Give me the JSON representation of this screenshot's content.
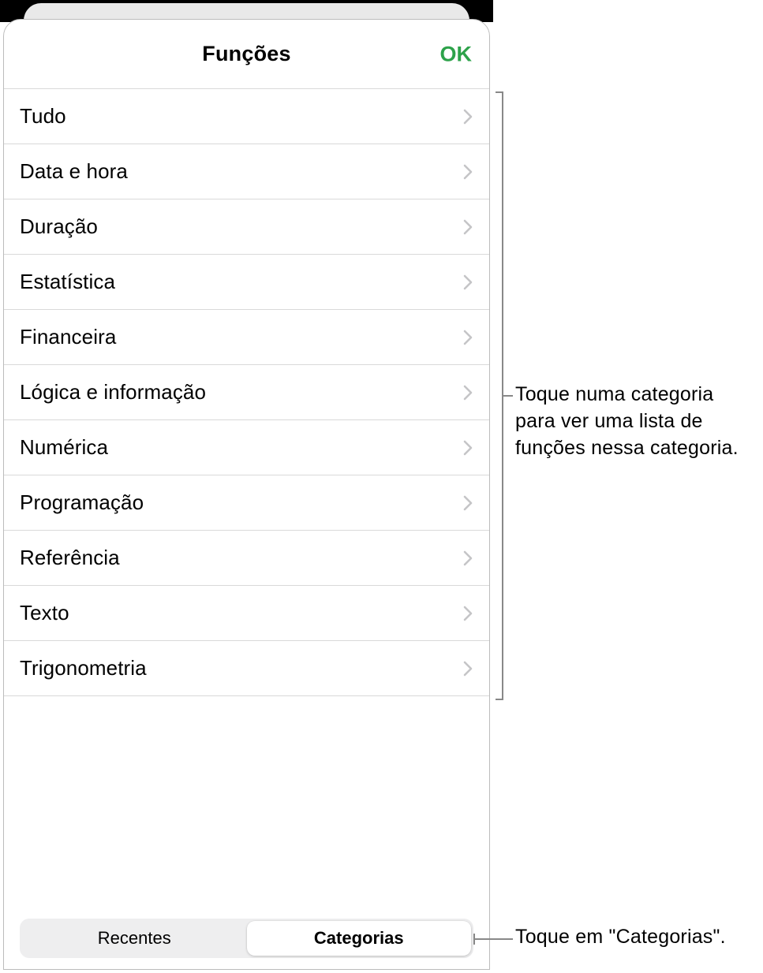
{
  "sheet": {
    "title": "Funções",
    "ok_label": "OK"
  },
  "categories": [
    {
      "label": "Tudo"
    },
    {
      "label": "Data e hora"
    },
    {
      "label": "Duração"
    },
    {
      "label": "Estatística"
    },
    {
      "label": "Financeira"
    },
    {
      "label": "Lógica e informação"
    },
    {
      "label": "Numérica"
    },
    {
      "label": "Programação"
    },
    {
      "label": "Referência"
    },
    {
      "label": "Texto"
    },
    {
      "label": "Trigonometria"
    }
  ],
  "segmented": {
    "recent_label": "Recentes",
    "categories_label": "Categorias",
    "selected": "categories"
  },
  "callouts": {
    "list": "Toque numa categoria para ver uma lista de funções nessa categoria.",
    "segment": "Toque em \"Categorias\"."
  }
}
